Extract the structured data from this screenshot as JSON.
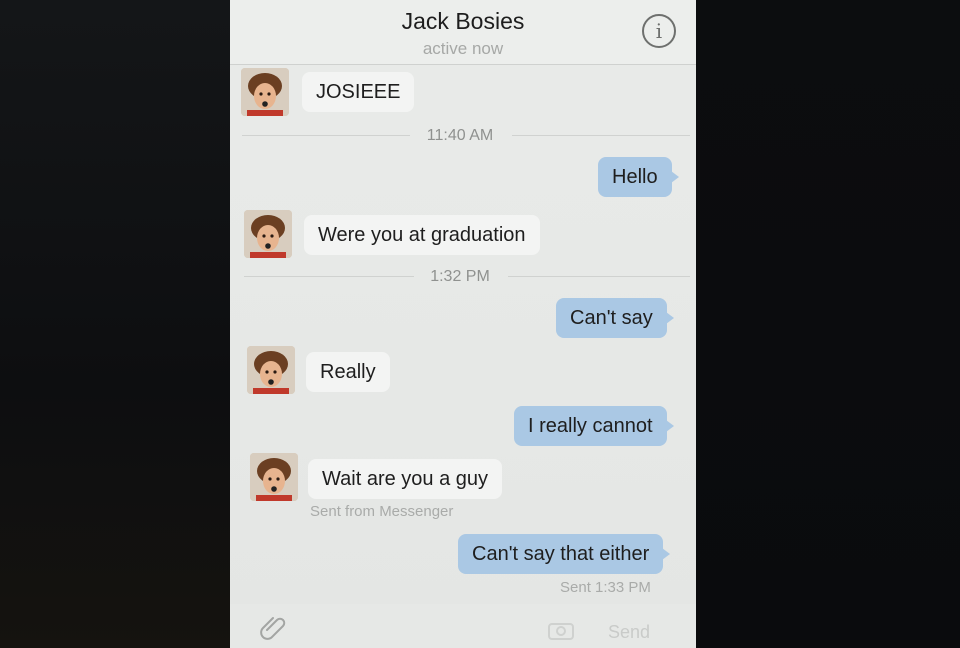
{
  "header": {
    "contact_name": "Jack Bosies",
    "status": "active now",
    "info_icon": "info-icon"
  },
  "messages": [
    {
      "from": "them",
      "text": "JOSIEEE"
    },
    {
      "type": "timestamp",
      "text": "11:40 AM"
    },
    {
      "from": "me",
      "text": "Hello"
    },
    {
      "from": "them",
      "text": "Were you at graduation"
    },
    {
      "type": "timestamp",
      "text": "1:32 PM"
    },
    {
      "from": "me",
      "text": "Can't say"
    },
    {
      "from": "them",
      "text": "Really"
    },
    {
      "from": "me",
      "text": "I really cannot"
    },
    {
      "from": "them",
      "text": "Wait are you a guy",
      "meta": "Sent from Messenger"
    },
    {
      "from": "me",
      "text": "Can't say that either",
      "meta": "Sent 1:33 PM"
    }
  ],
  "composer": {
    "attach_icon": "paperclip-icon",
    "camera_icon": "camera-icon",
    "send_label": "Send"
  },
  "colors": {
    "outgoing_bubble": "#aac8e4",
    "incoming_bubble": "#f3f4f3",
    "background": "#e9ebe9"
  }
}
